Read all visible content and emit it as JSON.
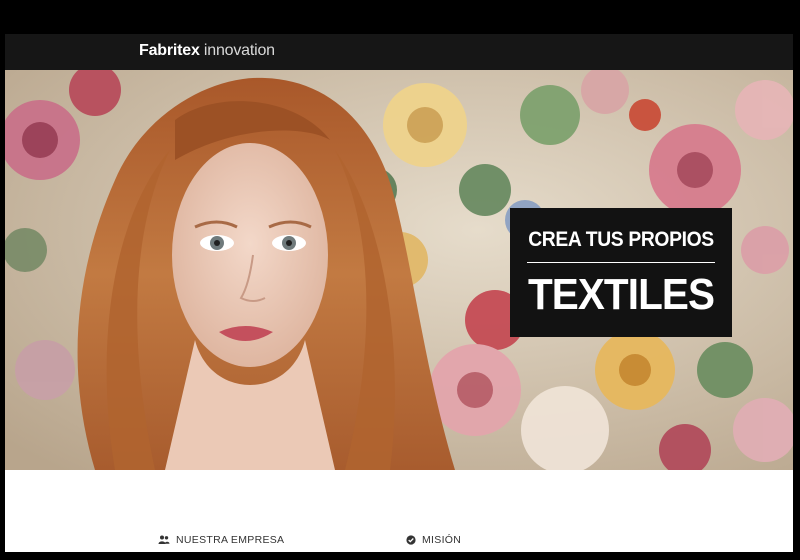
{
  "brand": {
    "name_strong": "Fabritex",
    "name_light": " innovation"
  },
  "hero": {
    "headline_small": "CREA TUS PROPIOS",
    "headline_large": "TEXTILES"
  },
  "sections": {
    "items": [
      {
        "label": "NUESTRA EMPRESA",
        "icon": "users-icon"
      },
      {
        "label": "MISIÓN",
        "icon": "check-circle-icon"
      }
    ]
  },
  "colors": {
    "navbar_bg": "#161616",
    "hero_card_bg": "#121212",
    "page_bg": "#ffffff",
    "hair": "#b5672f"
  }
}
